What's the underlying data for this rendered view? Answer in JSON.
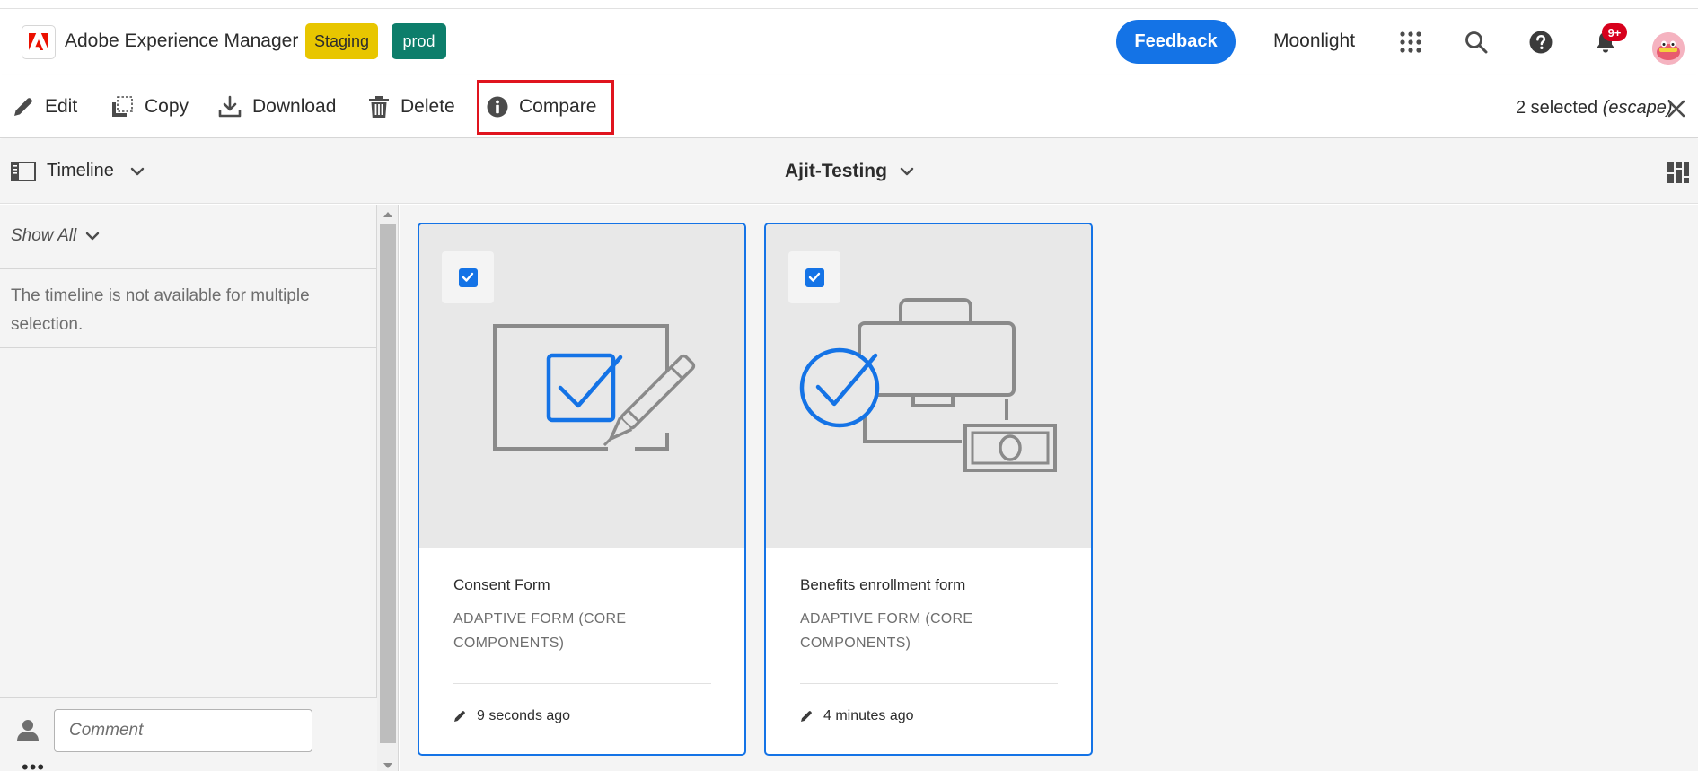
{
  "header": {
    "app_title": "Adobe Experience Manager",
    "env_staging": "Staging",
    "env_prod": "prod",
    "feedback_label": "Feedback",
    "user_name": "Moonlight",
    "notification_count": "9+",
    "icons": [
      "adobe-logo-icon",
      "apps-grid-icon",
      "search-icon",
      "help-icon",
      "bell-icon",
      "avatar"
    ]
  },
  "actionbar": {
    "actions": [
      {
        "label": "Edit",
        "icon": "pencil-icon"
      },
      {
        "label": "Copy",
        "icon": "copy-icon"
      },
      {
        "label": "Download",
        "icon": "download-icon"
      },
      {
        "label": "Delete",
        "icon": "trash-icon"
      },
      {
        "label": "Compare",
        "icon": "info-icon"
      }
    ],
    "selection_count": "2 selected",
    "escape_hint": "(escape)"
  },
  "subheader": {
    "rail_label": "Timeline",
    "folder_title": "Ajit-Testing"
  },
  "rail": {
    "filter_label": "Show All",
    "message": "The timeline is not available for multiple selection.",
    "comment_placeholder": "Comment",
    "more_label": "•••"
  },
  "cards": [
    {
      "title": "Consent Form",
      "type": "ADAPTIVE FORM (CORE COMPONENTS)",
      "modified": "9 seconds ago",
      "selected": true,
      "illustration": "form-checkbox-pen-illustration"
    },
    {
      "title": "Benefits enrollment form",
      "type": "ADAPTIVE FORM (CORE COMPONENTS)",
      "modified": "4 minutes ago",
      "selected": true,
      "illustration": "briefcase-money-check-illustration"
    }
  ],
  "colors": {
    "accent": "#1473e6",
    "staging": "#e8c600",
    "prod": "#0d7e6b",
    "highlight": "#e0141e",
    "notification": "#d7001c"
  }
}
